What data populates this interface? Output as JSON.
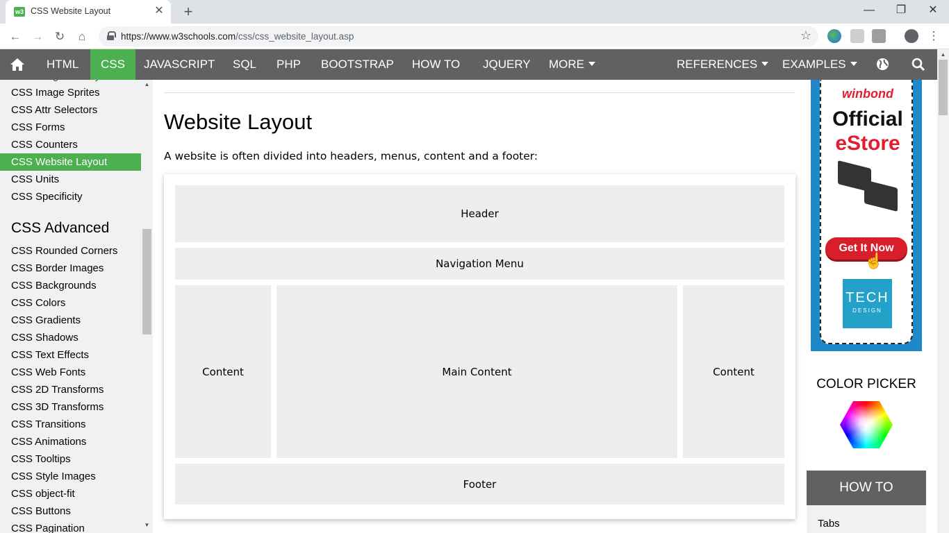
{
  "browser": {
    "tab_title": "CSS Website Layout",
    "favicon_text": "w3",
    "new_tab": "+",
    "url_host": "https://www.w3schools.com",
    "url_path": "/css/css_website_layout.asp",
    "window_controls": {
      "minimize": "—",
      "restore": "❐",
      "close": "✕"
    }
  },
  "topnav": {
    "items": [
      "HTML",
      "CSS",
      "JAVASCRIPT",
      "SQL",
      "PHP",
      "BOOTSTRAP",
      "HOW TO",
      "JQUERY",
      "MORE"
    ],
    "active": "CSS",
    "right_items": [
      "REFERENCES",
      "EXAMPLES"
    ]
  },
  "sidebar": {
    "links_top": [
      "CSS Image Sprites",
      "CSS Attr Selectors",
      "CSS Forms",
      "CSS Counters",
      "CSS Website Layout",
      "CSS Units",
      "CSS Specificity"
    ],
    "active": "CSS Website Layout",
    "advanced_heading": "CSS Advanced",
    "links_advanced": [
      "CSS Rounded Corners",
      "CSS Border Images",
      "CSS Backgrounds",
      "CSS Colors",
      "CSS Gradients",
      "CSS Shadows",
      "CSS Text Effects",
      "CSS Web Fonts",
      "CSS 2D Transforms",
      "CSS 3D Transforms",
      "CSS Transitions",
      "CSS Animations",
      "CSS Tooltips",
      "CSS Style Images",
      "CSS object-fit",
      "CSS Buttons",
      "CSS Pagination"
    ]
  },
  "main": {
    "title": "Website Layout",
    "intro": "A website is often divided into headers, menus, content and a footer:",
    "layout": {
      "header": "Header",
      "nav": "Navigation Menu",
      "left": "Content",
      "center": "Main Content",
      "right": "Content",
      "footer": "Footer"
    }
  },
  "ad": {
    "brand": "winbond",
    "line1": "Official",
    "line2": "eStore",
    "cta": "Get It Now",
    "tech1": "TECH",
    "tech2": "DESIGN"
  },
  "right": {
    "color_picker": "COLOR PICKER",
    "howto": "HOW TO",
    "howto_first": "Tabs"
  },
  "colors": {
    "accent": "#4caf50",
    "nav_bg": "#616161",
    "sidebar_bg": "#f1f1f1"
  }
}
